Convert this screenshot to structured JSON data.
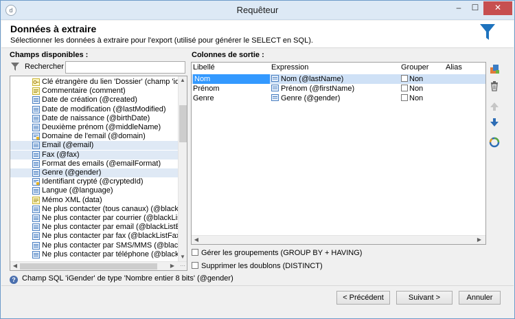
{
  "window": {
    "title": "Requêteur"
  },
  "header": {
    "title": "Données à extraire",
    "description": "Sélectionner les données à extraire pour l'export (utilisé pour générer le SELECT en SQL)."
  },
  "left_panel": {
    "label": "Champs disponibles :",
    "search_label": "Rechercher :",
    "search_value": "",
    "items": [
      {
        "text": "Clé étrangère du lien 'Dossier' (champ 'id') (@",
        "icon": "key-field-icon"
      },
      {
        "text": "Commentaire (comment)",
        "icon": "memo-field-icon"
      },
      {
        "text": "Date de création (@created)",
        "icon": "field-icon"
      },
      {
        "text": "Date de modification (@lastModified)",
        "icon": "field-icon"
      },
      {
        "text": "Date de naissance (@birthDate)",
        "icon": "field-icon"
      },
      {
        "text": "Deuxième prénom (@middleName)",
        "icon": "field-icon"
      },
      {
        "text": "Domaine de l'email (@domain)",
        "icon": "computed-field-icon"
      },
      {
        "text": "Email (@email)",
        "icon": "field-icon",
        "selected": true
      },
      {
        "text": "Fax (@fax)",
        "icon": "field-icon",
        "selected": true
      },
      {
        "text": "Format des emails (@emailFormat)",
        "icon": "field-icon"
      },
      {
        "text": "Genre (@gender)",
        "icon": "field-icon",
        "selected": true
      },
      {
        "text": "Identifiant crypté (@cryptedId)",
        "icon": "computed-field-icon"
      },
      {
        "text": "Langue (@language)",
        "icon": "field-icon"
      },
      {
        "text": "Mémo XML (data)",
        "icon": "memo-field-icon"
      },
      {
        "text": "Ne plus contacter (tous canaux) (@blackList)",
        "icon": "field-icon"
      },
      {
        "text": "Ne plus contacter par courrier (@blackListPos",
        "icon": "field-icon"
      },
      {
        "text": "Ne plus contacter par email (@blackListEmail",
        "icon": "field-icon"
      },
      {
        "text": "Ne plus contacter par fax (@blackListFax)",
        "icon": "field-icon"
      },
      {
        "text": "Ne plus contacter par SMS/MMS (@blackListl",
        "icon": "field-icon"
      },
      {
        "text": "Ne plus contacter par téléphone (@blackListP",
        "icon": "field-icon"
      }
    ]
  },
  "right_panel": {
    "label": "Colonnes de sortie :",
    "columns": [
      "Libellé",
      "Expression",
      "Grouper",
      "Alias"
    ],
    "rows": [
      {
        "label": "Nom",
        "expression": "Nom (@lastName)",
        "group": "Non",
        "alias": "",
        "selected": true
      },
      {
        "label": "Prénom",
        "expression": "Prénom (@firstName)",
        "group": "Non",
        "alias": ""
      },
      {
        "label": "Genre",
        "expression": "Genre (@gender)",
        "group": "Non",
        "alias": ""
      }
    ],
    "option_group_by": "Gérer les groupements (GROUP BY + HAVING)",
    "option_distinct": "Supprimer les doublons (DISTINCT)"
  },
  "info": {
    "text": "Champ SQL 'iGender' de type 'Nombre entier 8 bits' (@gender)"
  },
  "buttons": {
    "previous": "< Précédent",
    "next": "Suivant >",
    "cancel": "Annuler"
  },
  "colors": {
    "selection": "#3399ff",
    "row_highlight": "#cfe1f6",
    "title_bar": "#dde9f5",
    "close": "#c74f50",
    "funnel": "#1e73be"
  }
}
